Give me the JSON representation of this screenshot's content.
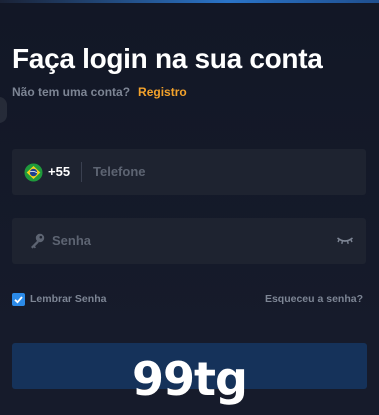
{
  "header": {
    "title": "Faça login na sua conta",
    "no_account_text": "Não tem uma conta?",
    "register_link": "Registro"
  },
  "phone_field": {
    "country_flag_icon": "brazil-flag-icon",
    "dial_code": "+55",
    "placeholder": "Telefone",
    "value": ""
  },
  "password_field": {
    "leading_icon": "key-icon",
    "placeholder": "Senha",
    "value": "",
    "toggle_icon": "eye-closed-icon"
  },
  "options": {
    "remember_label": "Lembrar Senha",
    "remember_checked": true,
    "forgot_link": "Esqueceu a senha?"
  },
  "login_button": {
    "label": ""
  },
  "watermark": {
    "text": "99tg"
  },
  "colors": {
    "background": "#161b2b",
    "field_bg": "#1e2330",
    "accent_orange": "#f3a22b",
    "accent_blue": "#2b8ae8",
    "button_bg": "#15325a",
    "muted_text": "#7d8594"
  }
}
